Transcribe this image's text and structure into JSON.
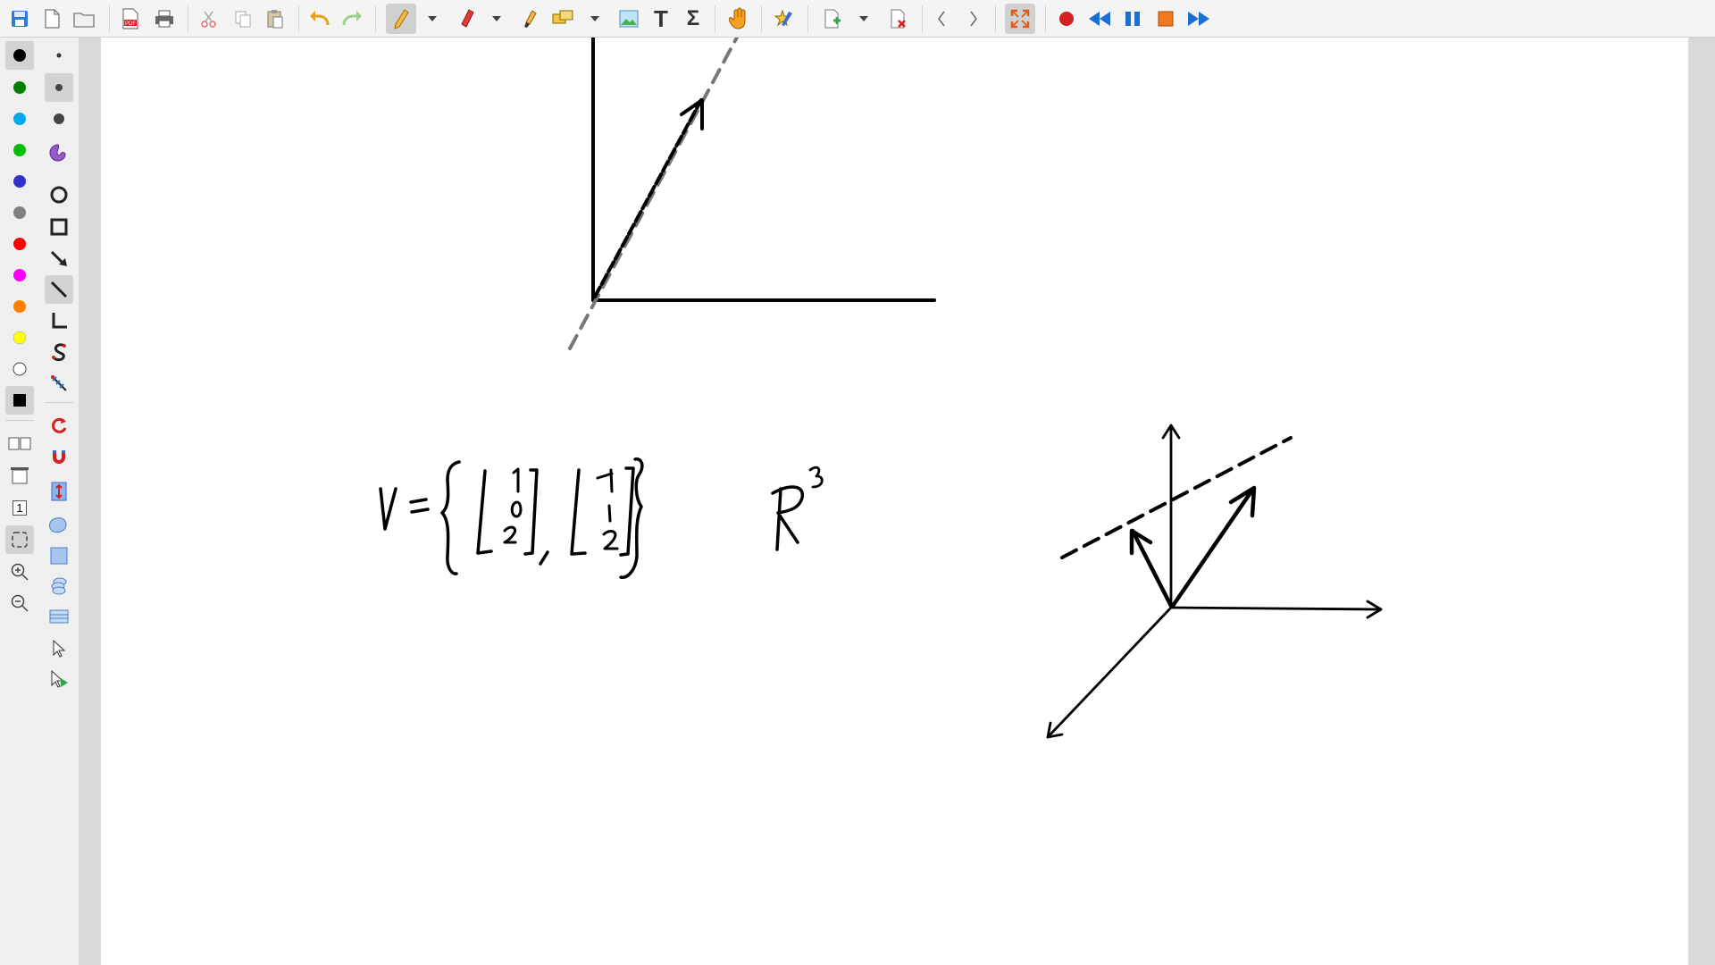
{
  "window": {
    "title": ""
  },
  "toolbar": {
    "buttons": [
      {
        "id": "save",
        "icon": "save-icon"
      },
      {
        "id": "new",
        "icon": "new-document-icon"
      },
      {
        "id": "open",
        "icon": "open-folder-icon"
      },
      {
        "id": "export_pdf",
        "icon": "pdf-icon",
        "label": "PDF"
      },
      {
        "id": "print",
        "icon": "printer-icon"
      },
      {
        "id": "cut",
        "icon": "scissors-icon"
      },
      {
        "id": "copy",
        "icon": "copy-icon"
      },
      {
        "id": "paste",
        "icon": "paste-icon"
      },
      {
        "id": "undo",
        "icon": "undo-icon"
      },
      {
        "id": "redo",
        "icon": "redo-icon"
      },
      {
        "id": "pen",
        "icon": "pencil-icon",
        "active": true
      },
      {
        "id": "eraser",
        "icon": "eraser-icon"
      },
      {
        "id": "highlighter",
        "icon": "highlighter-icon"
      },
      {
        "id": "select_region",
        "icon": "select-region-icon"
      },
      {
        "id": "image",
        "icon": "image-icon"
      },
      {
        "id": "text",
        "icon": "text-icon",
        "label": "T"
      },
      {
        "id": "latex",
        "icon": "sigma-icon",
        "label": "Σ"
      },
      {
        "id": "hand",
        "icon": "hand-icon"
      },
      {
        "id": "favorite",
        "icon": "star-pen-icon"
      },
      {
        "id": "add_page",
        "icon": "add-page-icon"
      },
      {
        "id": "delete_page",
        "icon": "delete-page-icon"
      },
      {
        "id": "prev_page",
        "icon": "chevron-left-icon"
      },
      {
        "id": "next_page",
        "icon": "chevron-right-icon"
      },
      {
        "id": "fullscreen",
        "icon": "fullscreen-icon",
        "active": true
      },
      {
        "id": "record",
        "icon": "record-icon"
      },
      {
        "id": "rewind",
        "icon": "rewind-icon"
      },
      {
        "id": "pause",
        "icon": "pause-icon"
      },
      {
        "id": "stop",
        "icon": "stop-icon"
      },
      {
        "id": "fast_forward",
        "icon": "fast-forward-icon"
      }
    ]
  },
  "colors": {
    "palette": [
      "#000000",
      "#008000",
      "#00a8ec",
      "#00c000",
      "#3333cc",
      "#808080",
      "#ff0000",
      "#ff00ff",
      "#ff8000",
      "#ffff00",
      "#ffffff",
      "#000000"
    ],
    "selected": "#000000",
    "ink": "#000000",
    "dashed_gray": "#777777",
    "accent_blue": "#1a6fd1",
    "accent_red": "#d61f1f",
    "accent_orange": "#f0781e"
  },
  "left_tools": [
    {
      "icon": "dot-small-icon"
    },
    {
      "icon": "dot-medium-icon"
    },
    {
      "icon": "dot-large-icon"
    },
    {
      "icon": "fill-icon"
    },
    {
      "icon": "circle-icon"
    },
    {
      "icon": "rectangle-icon"
    },
    {
      "icon": "arrow-icon"
    },
    {
      "icon": "line-icon"
    },
    {
      "icon": "coordinate-icon"
    },
    {
      "icon": "spline-icon"
    },
    {
      "icon": "ruler-icon"
    },
    {
      "icon": "rotate-snap-icon"
    },
    {
      "icon": "magnet-icon"
    },
    {
      "icon": "vertical-space-icon"
    },
    {
      "icon": "shape-recognizer-icon"
    },
    {
      "icon": "fill-rect-icon"
    },
    {
      "icon": "layers-icon"
    },
    {
      "icon": "layer-icon"
    },
    {
      "icon": "cursor-icon"
    },
    {
      "icon": "play-cursor-icon"
    }
  ],
  "left_views": [
    {
      "icon": "two-pages-icon"
    },
    {
      "icon": "presentation-icon"
    },
    {
      "icon": "page-number-icon",
      "label": "1"
    },
    {
      "icon": "select-area-icon"
    },
    {
      "icon": "zoom-in-icon"
    },
    {
      "icon": "zoom-out-icon"
    }
  ],
  "canvas": {
    "handwriting": {
      "equation_lhs": "V",
      "vector1": [
        "1",
        "0",
        "2"
      ],
      "vector2": [
        "-1",
        "1",
        "2"
      ],
      "space_symbol": "R",
      "space_exponent": "3"
    }
  }
}
